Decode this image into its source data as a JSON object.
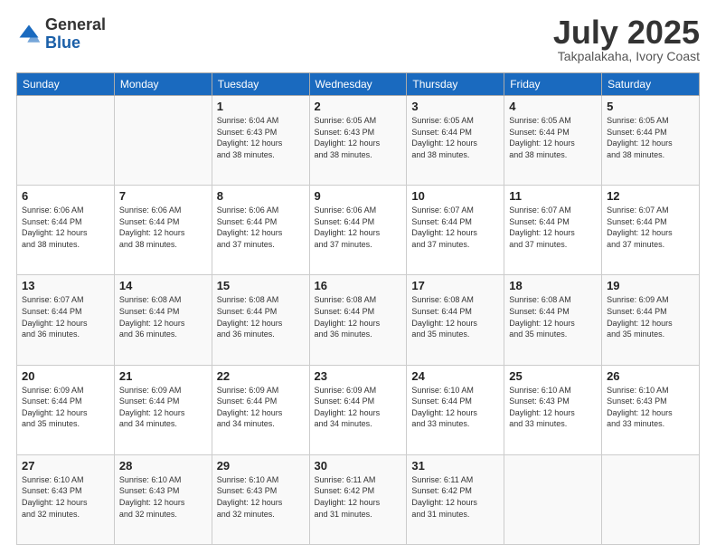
{
  "header": {
    "logo_general": "General",
    "logo_blue": "Blue",
    "month_year": "July 2025",
    "location": "Takpalakaha, Ivory Coast"
  },
  "days_of_week": [
    "Sunday",
    "Monday",
    "Tuesday",
    "Wednesday",
    "Thursday",
    "Friday",
    "Saturday"
  ],
  "weeks": [
    [
      {
        "day": "",
        "content": ""
      },
      {
        "day": "",
        "content": ""
      },
      {
        "day": "1",
        "content": "Sunrise: 6:04 AM\nSunset: 6:43 PM\nDaylight: 12 hours\nand 38 minutes."
      },
      {
        "day": "2",
        "content": "Sunrise: 6:05 AM\nSunset: 6:43 PM\nDaylight: 12 hours\nand 38 minutes."
      },
      {
        "day": "3",
        "content": "Sunrise: 6:05 AM\nSunset: 6:44 PM\nDaylight: 12 hours\nand 38 minutes."
      },
      {
        "day": "4",
        "content": "Sunrise: 6:05 AM\nSunset: 6:44 PM\nDaylight: 12 hours\nand 38 minutes."
      },
      {
        "day": "5",
        "content": "Sunrise: 6:05 AM\nSunset: 6:44 PM\nDaylight: 12 hours\nand 38 minutes."
      }
    ],
    [
      {
        "day": "6",
        "content": "Sunrise: 6:06 AM\nSunset: 6:44 PM\nDaylight: 12 hours\nand 38 minutes."
      },
      {
        "day": "7",
        "content": "Sunrise: 6:06 AM\nSunset: 6:44 PM\nDaylight: 12 hours\nand 38 minutes."
      },
      {
        "day": "8",
        "content": "Sunrise: 6:06 AM\nSunset: 6:44 PM\nDaylight: 12 hours\nand 37 minutes."
      },
      {
        "day": "9",
        "content": "Sunrise: 6:06 AM\nSunset: 6:44 PM\nDaylight: 12 hours\nand 37 minutes."
      },
      {
        "day": "10",
        "content": "Sunrise: 6:07 AM\nSunset: 6:44 PM\nDaylight: 12 hours\nand 37 minutes."
      },
      {
        "day": "11",
        "content": "Sunrise: 6:07 AM\nSunset: 6:44 PM\nDaylight: 12 hours\nand 37 minutes."
      },
      {
        "day": "12",
        "content": "Sunrise: 6:07 AM\nSunset: 6:44 PM\nDaylight: 12 hours\nand 37 minutes."
      }
    ],
    [
      {
        "day": "13",
        "content": "Sunrise: 6:07 AM\nSunset: 6:44 PM\nDaylight: 12 hours\nand 36 minutes."
      },
      {
        "day": "14",
        "content": "Sunrise: 6:08 AM\nSunset: 6:44 PM\nDaylight: 12 hours\nand 36 minutes."
      },
      {
        "day": "15",
        "content": "Sunrise: 6:08 AM\nSunset: 6:44 PM\nDaylight: 12 hours\nand 36 minutes."
      },
      {
        "day": "16",
        "content": "Sunrise: 6:08 AM\nSunset: 6:44 PM\nDaylight: 12 hours\nand 36 minutes."
      },
      {
        "day": "17",
        "content": "Sunrise: 6:08 AM\nSunset: 6:44 PM\nDaylight: 12 hours\nand 35 minutes."
      },
      {
        "day": "18",
        "content": "Sunrise: 6:08 AM\nSunset: 6:44 PM\nDaylight: 12 hours\nand 35 minutes."
      },
      {
        "day": "19",
        "content": "Sunrise: 6:09 AM\nSunset: 6:44 PM\nDaylight: 12 hours\nand 35 minutes."
      }
    ],
    [
      {
        "day": "20",
        "content": "Sunrise: 6:09 AM\nSunset: 6:44 PM\nDaylight: 12 hours\nand 35 minutes."
      },
      {
        "day": "21",
        "content": "Sunrise: 6:09 AM\nSunset: 6:44 PM\nDaylight: 12 hours\nand 34 minutes."
      },
      {
        "day": "22",
        "content": "Sunrise: 6:09 AM\nSunset: 6:44 PM\nDaylight: 12 hours\nand 34 minutes."
      },
      {
        "day": "23",
        "content": "Sunrise: 6:09 AM\nSunset: 6:44 PM\nDaylight: 12 hours\nand 34 minutes."
      },
      {
        "day": "24",
        "content": "Sunrise: 6:10 AM\nSunset: 6:44 PM\nDaylight: 12 hours\nand 33 minutes."
      },
      {
        "day": "25",
        "content": "Sunrise: 6:10 AM\nSunset: 6:43 PM\nDaylight: 12 hours\nand 33 minutes."
      },
      {
        "day": "26",
        "content": "Sunrise: 6:10 AM\nSunset: 6:43 PM\nDaylight: 12 hours\nand 33 minutes."
      }
    ],
    [
      {
        "day": "27",
        "content": "Sunrise: 6:10 AM\nSunset: 6:43 PM\nDaylight: 12 hours\nand 32 minutes."
      },
      {
        "day": "28",
        "content": "Sunrise: 6:10 AM\nSunset: 6:43 PM\nDaylight: 12 hours\nand 32 minutes."
      },
      {
        "day": "29",
        "content": "Sunrise: 6:10 AM\nSunset: 6:43 PM\nDaylight: 12 hours\nand 32 minutes."
      },
      {
        "day": "30",
        "content": "Sunrise: 6:11 AM\nSunset: 6:42 PM\nDaylight: 12 hours\nand 31 minutes."
      },
      {
        "day": "31",
        "content": "Sunrise: 6:11 AM\nSunset: 6:42 PM\nDaylight: 12 hours\nand 31 minutes."
      },
      {
        "day": "",
        "content": ""
      },
      {
        "day": "",
        "content": ""
      }
    ]
  ]
}
